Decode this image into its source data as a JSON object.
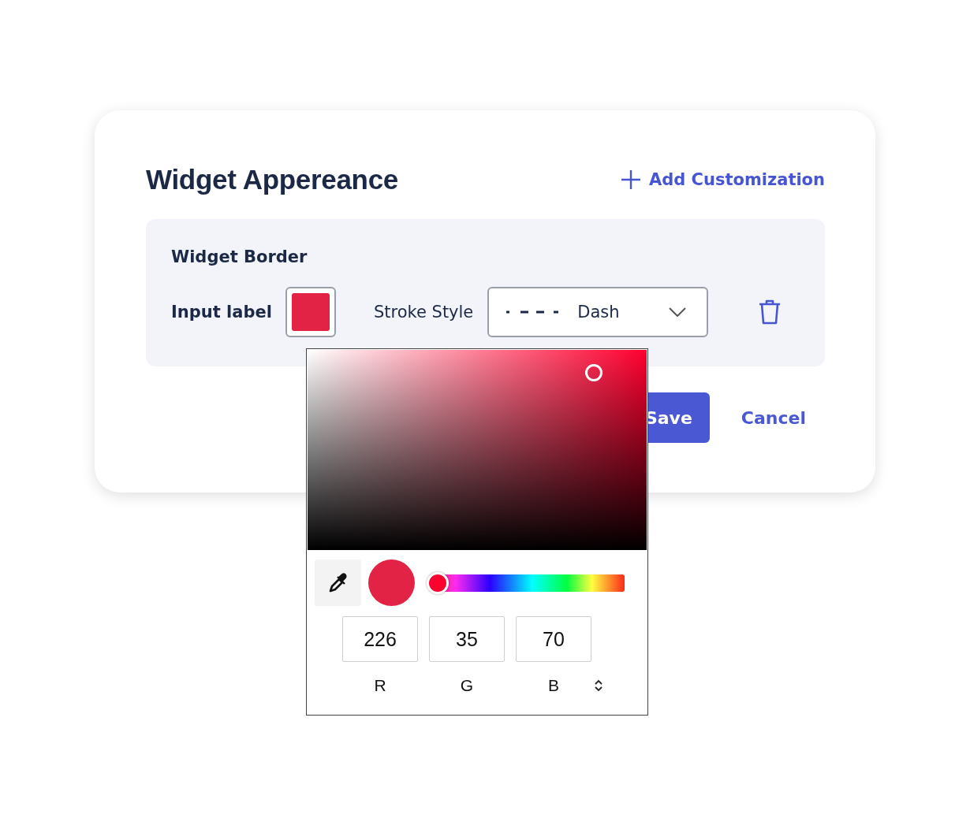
{
  "card": {
    "title": "Widget Appereance",
    "add_button": "Add Customization"
  },
  "panel": {
    "title": "Widget Border",
    "color_label": "Input label",
    "stroke_label": "Stroke Style",
    "stroke_select": {
      "value": "Dash"
    }
  },
  "actions": {
    "save": "Save",
    "cancel": "Cancel"
  },
  "color_picker": {
    "hue_slider": {
      "level": 0.03
    },
    "channels": [
      {
        "label": "R",
        "value": "226"
      },
      {
        "label": "G",
        "value": "35"
      },
      {
        "label": "B",
        "value": "70"
      }
    ]
  }
}
